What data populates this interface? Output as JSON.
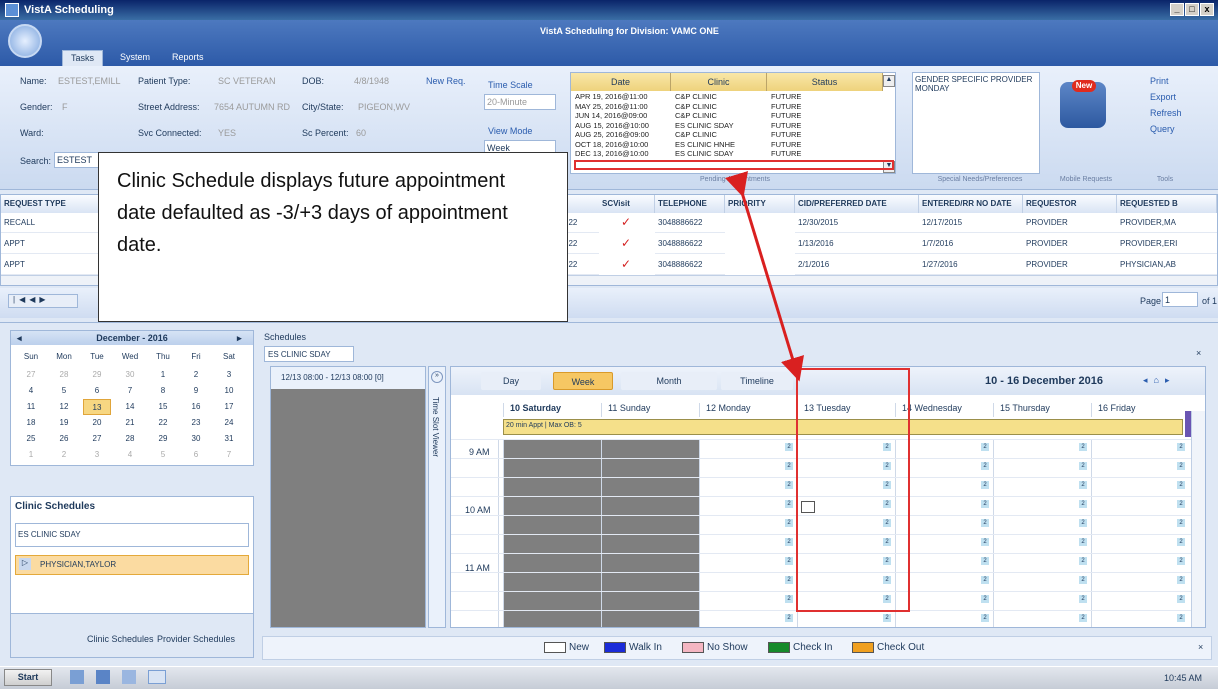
{
  "window": {
    "title": "VistA Scheduling",
    "subtitle": "VistA Scheduling for Division: VAMC ONE",
    "min": "_",
    "max": "□",
    "close": "x"
  },
  "tabs": [
    "Tasks",
    "System",
    "Reports"
  ],
  "patient": {
    "name_label": "Name:",
    "name": "ESTEST,EMILL",
    "type_label": "Patient Type:",
    "type": "SC VETERAN",
    "dob_label": "DOB:",
    "dob": "4/8/1948",
    "newreq": "New Req.",
    "gender_label": "Gender:",
    "gender": "F",
    "street_label": "Street Address:",
    "street": "7654 AUTUMN RD",
    "city_label": "City/State:",
    "city": "PIGEON,WV",
    "ward_label": "Ward:",
    "svc_label": "Svc Connected:",
    "svc": "YES",
    "scp_label": "Sc Percent:",
    "scp": "60",
    "search_label": "Search:",
    "search_value": "ESTEST"
  },
  "timescale": {
    "label": "Time Scale",
    "value": "20-Minute",
    "viewmode_label": "View Mode",
    "viewmode": "Week"
  },
  "appointments": {
    "headers": [
      "Date",
      "Clinic",
      "Status"
    ],
    "rows": [
      [
        "APR 19, 2016@11:00",
        "C&P CLINIC",
        "FUTURE"
      ],
      [
        "MAY 25, 2016@11:00",
        "C&P CLINIC",
        "FUTURE"
      ],
      [
        "JUN 14, 2016@09:00",
        "C&P CLINIC",
        "FUTURE"
      ],
      [
        "AUG 15, 2016@10:00",
        "ES CLINIC SDAY",
        "FUTURE"
      ],
      [
        "AUG 25, 2016@09:00",
        "C&P CLINIC",
        "FUTURE"
      ],
      [
        "OCT 18, 2016@10:00",
        "ES CLINIC HNHE",
        "FUTURE"
      ],
      [
        "DEC 13, 2016@10:00",
        "ES CLINIC SDAY",
        "FUTURE"
      ]
    ],
    "group": "Pending Appointments"
  },
  "special": {
    "text": "GENDER SPECIFIC PROVIDER MONDAY",
    "group": "Special Needs/Preferences"
  },
  "mobile": {
    "badge": "New",
    "group": "Mobile Requests"
  },
  "tools": {
    "items": [
      "Print",
      "Export",
      "Refresh",
      "Query"
    ],
    "group": "Tools"
  },
  "requests": {
    "headers": [
      "REQUEST TYPE",
      "SCVisit",
      "TELEPHONE",
      "PRIORITY",
      "CID/PREFERRED DATE",
      "ENTERED/RR NO DATE",
      "REQUESTOR",
      "REQUESTED B"
    ],
    "rows": [
      {
        "type": "RECALL",
        "tel_prefix": "922",
        "tel": "3048886622",
        "cid": "12/30/2015",
        "entered": "12/17/2015",
        "requestor": "PROVIDER",
        "requested": "PROVIDER,MA"
      },
      {
        "type": "APPT",
        "tel_prefix": "922",
        "tel": "3048886622",
        "cid": "1/13/2016",
        "entered": "1/7/2016",
        "requestor": "PROVIDER",
        "requested": "PROVIDER,ERI"
      },
      {
        "type": "APPT",
        "tel_prefix": "922",
        "tel": "3048886622",
        "cid": "2/1/2016",
        "entered": "1/27/2016",
        "requestor": "PROVIDER",
        "requested": "PHYSICIAN,AB"
      }
    ]
  },
  "pager": {
    "label": "Page",
    "page": "1",
    "of": "of 1"
  },
  "callout": "Clinic Schedule displays future appointment date defaulted as -3/+3 days of appointment date.",
  "calendar": {
    "title": "December - 2016",
    "days": [
      "Sun",
      "Mon",
      "Tue",
      "Wed",
      "Thu",
      "Fri",
      "Sat"
    ],
    "weeks": [
      [
        "27",
        "28",
        "29",
        "30",
        "1",
        "2",
        "3"
      ],
      [
        "4",
        "5",
        "6",
        "7",
        "8",
        "9",
        "10"
      ],
      [
        "11",
        "12",
        "13",
        "14",
        "15",
        "16",
        "17"
      ],
      [
        "18",
        "19",
        "20",
        "21",
        "22",
        "23",
        "24"
      ],
      [
        "25",
        "26",
        "27",
        "28",
        "29",
        "30",
        "31"
      ],
      [
        "1",
        "2",
        "3",
        "4",
        "5",
        "6",
        "7"
      ]
    ]
  },
  "clinic_schedules": {
    "title": "Clinic Schedules",
    "clinic": "ES CLINIC SDAY",
    "provider": "PHYSICIAN,TAYLOR",
    "tab1": "Clinic Schedules",
    "tab2": "Provider Schedules"
  },
  "schedules": {
    "label": "Schedules",
    "tab": "ES CLINIC SDAY",
    "slot": "12/13 08:00 - 12/13 08:00  [0]",
    "tsv": "Time Slot Viewer",
    "views": [
      "Day",
      "Week",
      "Month",
      "Timeline"
    ],
    "range": "10 - 16 December 2016",
    "days": [
      "10 Saturday",
      "11 Sunday",
      "12 Monday",
      "13 Tuesday",
      "14 Wednesday",
      "15 Thursday",
      "16 Friday"
    ],
    "allday": "20 min Appt | Max OB: 5",
    "hours": [
      "9 AM",
      "10 AM",
      "11 AM"
    ]
  },
  "legend": [
    "New",
    "Walk In",
    "No Show",
    "Check In",
    "Check Out"
  ],
  "legend_colors": [
    "#ffffff",
    "#1a2bd8",
    "#f4b6c2",
    "#168a2a",
    "#f0a020"
  ],
  "taskbar": {
    "start": "Start",
    "time": "10:45 AM"
  }
}
